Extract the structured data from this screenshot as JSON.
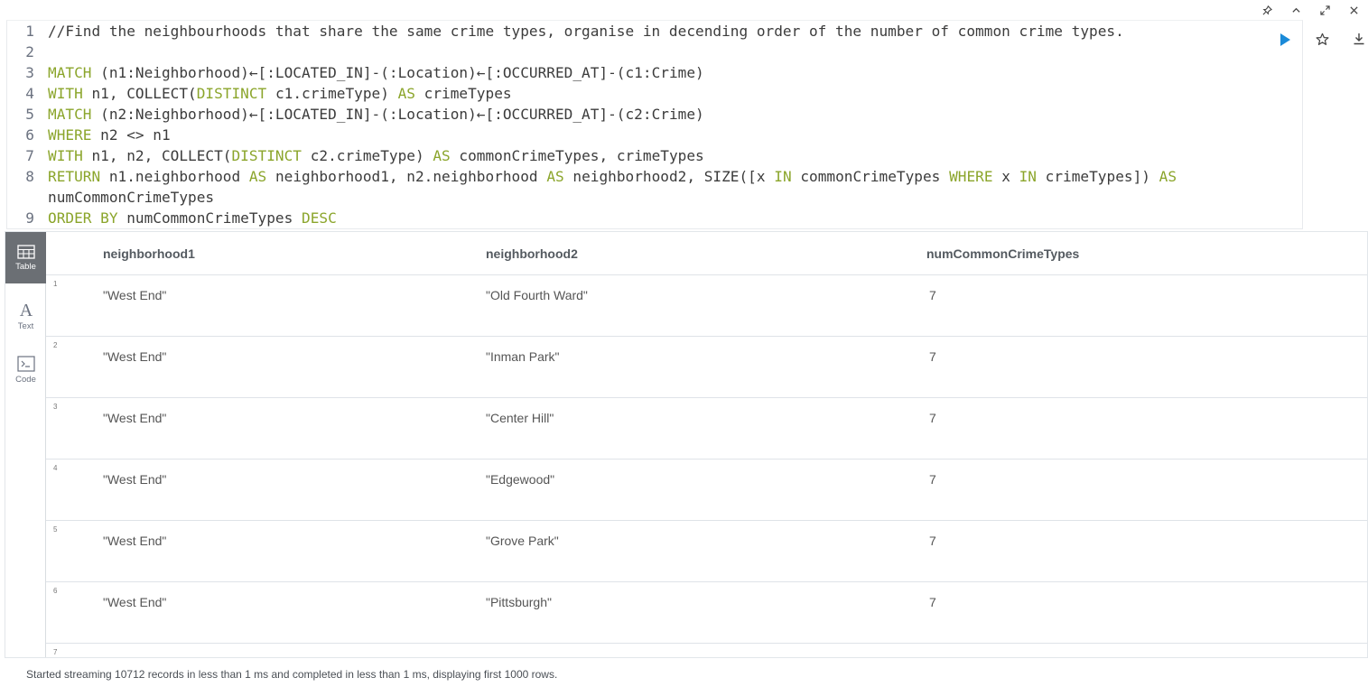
{
  "window_controls": [
    {
      "name": "pin-icon",
      "glyph": "📌"
    },
    {
      "name": "collapse-icon",
      "glyph": "⌃"
    },
    {
      "name": "fullscreen-icon",
      "glyph": "⤢"
    },
    {
      "name": "close-icon",
      "glyph": "✕"
    }
  ],
  "editor": {
    "lines": [
      {
        "n": "1",
        "parts": [
          {
            "t": "//Find the neighbourhoods that share the same crime types, organise in decending order of the number of common crime types.",
            "c": "cm"
          }
        ]
      },
      {
        "n": "2",
        "parts": []
      },
      {
        "n": "3",
        "parts": [
          {
            "t": "MATCH",
            "c": "kw"
          },
          {
            "t": " (n1:Neighborhood)←[:LOCATED_IN]-(:Location)←[:OCCURRED_AT]-(c1:Crime)",
            "c": "cm"
          }
        ]
      },
      {
        "n": "4",
        "parts": [
          {
            "t": "WITH",
            "c": "kw"
          },
          {
            "t": " n1, COLLECT(",
            "c": "cm"
          },
          {
            "t": "DISTINCT",
            "c": "kw"
          },
          {
            "t": " c1.crimeType) ",
            "c": "cm"
          },
          {
            "t": "AS",
            "c": "kw"
          },
          {
            "t": " crimeTypes",
            "c": "cm"
          }
        ]
      },
      {
        "n": "5",
        "parts": [
          {
            "t": "MATCH",
            "c": "kw"
          },
          {
            "t": " (n2:Neighborhood)←[:LOCATED_IN]-(:Location)←[:OCCURRED_AT]-(c2:Crime)",
            "c": "cm"
          }
        ]
      },
      {
        "n": "6",
        "parts": [
          {
            "t": "WHERE",
            "c": "kw"
          },
          {
            "t": " n2 <> n1",
            "c": "cm"
          }
        ]
      },
      {
        "n": "7",
        "parts": [
          {
            "t": "WITH",
            "c": "kw"
          },
          {
            "t": " n1, n2, COLLECT(",
            "c": "cm"
          },
          {
            "t": "DISTINCT",
            "c": "kw"
          },
          {
            "t": " c2.crimeType) ",
            "c": "cm"
          },
          {
            "t": "AS",
            "c": "kw"
          },
          {
            "t": " commonCrimeTypes, crimeTypes",
            "c": "cm"
          }
        ]
      },
      {
        "n": "8",
        "parts": [
          {
            "t": "RETURN",
            "c": "kw"
          },
          {
            "t": " n1.neighborhood ",
            "c": "cm"
          },
          {
            "t": "AS",
            "c": "kw"
          },
          {
            "t": " neighborhood1, n2.neighborhood ",
            "c": "cm"
          },
          {
            "t": "AS",
            "c": "kw"
          },
          {
            "t": " neighborhood2, SIZE([x ",
            "c": "cm"
          },
          {
            "t": "IN",
            "c": "kw"
          },
          {
            "t": " commonCrimeTypes ",
            "c": "cm"
          },
          {
            "t": "WHERE",
            "c": "kw"
          },
          {
            "t": " x ",
            "c": "cm"
          },
          {
            "t": "IN",
            "c": "kw"
          },
          {
            "t": " crimeTypes]) ",
            "c": "cm"
          },
          {
            "t": "AS",
            "c": "kw"
          }
        ]
      },
      {
        "n": "",
        "parts": [
          {
            "t": "numCommonCrimeTypes",
            "c": "cm"
          }
        ]
      },
      {
        "n": "9",
        "parts": [
          {
            "t": "ORDER BY",
            "c": "kw"
          },
          {
            "t": " numCommonCrimeTypes ",
            "c": "cm"
          },
          {
            "t": "DESC",
            "c": "kw"
          }
        ]
      }
    ]
  },
  "editor_actions": [
    {
      "name": "run-button",
      "icon": "play-icon",
      "color": "#1a8ad8"
    },
    {
      "name": "favorite-button",
      "icon": "star-icon",
      "color": "#444444"
    },
    {
      "name": "download-button",
      "icon": "download-icon",
      "color": "#444444"
    }
  ],
  "sidebar": {
    "items": [
      {
        "label": "Table",
        "icon": "table-icon",
        "active": true
      },
      {
        "label": "Text",
        "icon": "text-icon",
        "active": false
      },
      {
        "label": "Code",
        "icon": "code-icon",
        "active": false
      }
    ]
  },
  "table": {
    "columns": [
      "neighborhood1",
      "neighborhood2",
      "numCommonCrimeTypes"
    ],
    "rows": [
      {
        "num": "1",
        "cells": [
          "\"West End\"",
          "\"Old Fourth Ward\"",
          "7"
        ]
      },
      {
        "num": "2",
        "cells": [
          "\"West End\"",
          "\"Inman Park\"",
          "7"
        ]
      },
      {
        "num": "3",
        "cells": [
          "\"West End\"",
          "\"Center Hill\"",
          "7"
        ]
      },
      {
        "num": "4",
        "cells": [
          "\"West End\"",
          "\"Edgewood\"",
          "7"
        ]
      },
      {
        "num": "5",
        "cells": [
          "\"West End\"",
          "\"Grove Park\"",
          "7"
        ]
      },
      {
        "num": "6",
        "cells": [
          "\"West End\"",
          "\"Pittsburgh\"",
          "7"
        ]
      },
      {
        "num": "7",
        "cells": [
          "",
          "",
          ""
        ]
      }
    ]
  },
  "status": {
    "text": "Started streaming 10712 records in less than 1 ms and completed in less than 1 ms, displaying first 1000 rows."
  }
}
